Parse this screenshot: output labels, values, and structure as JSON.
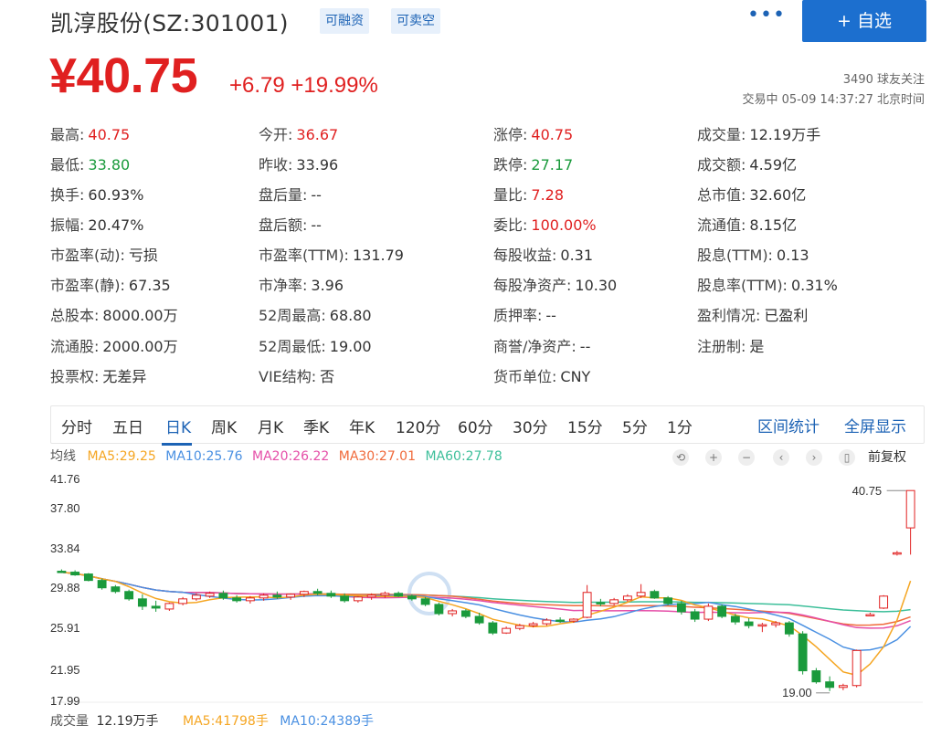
{
  "header": {
    "title": "凯淳股份(SZ:301001)",
    "tag1": "可融资",
    "tag2": "可卖空",
    "more": "•••",
    "add_button": "+ 自选"
  },
  "quote": {
    "price": "¥40.75",
    "change": "+6.79 +19.99%",
    "followers": "3490 球友关注",
    "trade_status": "交易中 05-09 14:37:27 北京时间"
  },
  "stats": [
    [
      {
        "k": "最高:",
        "v": "40.75",
        "c": "r"
      },
      {
        "k": "今开:",
        "v": "36.67",
        "c": "r"
      },
      {
        "k": "涨停:",
        "v": "40.75",
        "c": "r"
      },
      {
        "k": "成交量:",
        "v": "12.19万手",
        "c": "n"
      }
    ],
    [
      {
        "k": "最低:",
        "v": "33.80",
        "c": "g"
      },
      {
        "k": "昨收:",
        "v": "33.96",
        "c": "n"
      },
      {
        "k": "跌停:",
        "v": "27.17",
        "c": "g"
      },
      {
        "k": "成交额:",
        "v": "4.59亿",
        "c": "n"
      }
    ],
    [
      {
        "k": "换手:",
        "v": "60.93%",
        "c": "n"
      },
      {
        "k": "盘后量:",
        "v": "--",
        "c": "n"
      },
      {
        "k": "量比:",
        "v": "7.28",
        "c": "r"
      },
      {
        "k": "总市值:",
        "v": "32.60亿",
        "c": "n"
      }
    ],
    [
      {
        "k": "振幅:",
        "v": "20.47%",
        "c": "n"
      },
      {
        "k": "盘后额:",
        "v": "--",
        "c": "n"
      },
      {
        "k": "委比:",
        "v": "100.00%",
        "c": "r"
      },
      {
        "k": "流通值:",
        "v": "8.15亿",
        "c": "n"
      }
    ],
    [
      {
        "k": "市盈率(动):",
        "v": "亏损",
        "c": "n"
      },
      {
        "k": "市盈率(TTM):",
        "v": "131.79",
        "c": "n"
      },
      {
        "k": "每股收益:",
        "v": "0.31",
        "c": "n"
      },
      {
        "k": "股息(TTM):",
        "v": "0.13",
        "c": "n"
      }
    ],
    [
      {
        "k": "市盈率(静):",
        "v": "67.35",
        "c": "n"
      },
      {
        "k": "市净率:",
        "v": "3.96",
        "c": "n"
      },
      {
        "k": "每股净资产:",
        "v": "10.30",
        "c": "n"
      },
      {
        "k": "股息率(TTM):",
        "v": "0.31%",
        "c": "n"
      }
    ],
    [
      {
        "k": "总股本:",
        "v": "8000.00万",
        "c": "n"
      },
      {
        "k": "52周最高:",
        "v": "68.80",
        "c": "n"
      },
      {
        "k": "质押率:",
        "v": "--",
        "c": "n"
      },
      {
        "k": "盈利情况:",
        "v": "已盈利",
        "c": "n"
      }
    ],
    [
      {
        "k": "流通股:",
        "v": "2000.00万",
        "c": "n"
      },
      {
        "k": "52周最低:",
        "v": "19.00",
        "c": "n"
      },
      {
        "k": "商誉/净资产:",
        "v": "--",
        "c": "n"
      },
      {
        "k": "注册制:",
        "v": "是",
        "c": "n"
      }
    ],
    [
      {
        "k": "投票权:",
        "v": "无差异",
        "c": "n"
      },
      {
        "k": "VIE结构:",
        "v": "否",
        "c": "n"
      },
      {
        "k": "货币单位:",
        "v": "CNY",
        "c": "n"
      },
      null
    ]
  ],
  "tabs": [
    "分时",
    "五日",
    "日K",
    "周K",
    "月K",
    "季K",
    "年K",
    "120分",
    "60分",
    "30分",
    "15分",
    "5分",
    "1分"
  ],
  "active_tab": "日K",
  "tab_right": {
    "stats": "区间统计",
    "fullscreen": "全屏显示"
  },
  "ma_legend": {
    "label": "均线",
    "ma5": "MA5:29.25",
    "ma10": "MA10:25.76",
    "ma20": "MA20:26.22",
    "ma30": "MA30:27.01",
    "ma60": "MA60:27.78"
  },
  "controls": {
    "c1": "⟲",
    "c2": "+",
    "c3": "−",
    "c4": "‹",
    "c5": "›",
    "c6": "▯",
    "adjust": "前复权"
  },
  "colors": {
    "up": "#e02020",
    "down": "#1a9a3c",
    "ma5": "#f5a623",
    "ma10": "#4a90e2",
    "ma20": "#e54fa8",
    "ma30": "#f06a3b",
    "ma60": "#3dbf9a",
    "accent": "#1d63b5"
  },
  "chart_data": {
    "type": "candlestick",
    "y_ticks": [
      "41.76",
      "37.80",
      "33.84",
      "29.88",
      "25.91",
      "21.95",
      "17.99"
    ],
    "ylim": [
      17.99,
      41.76
    ],
    "max_label": "40.75",
    "min_label": "19.00",
    "candles": [
      [
        32.0,
        32.2,
        31.8,
        31.9
      ],
      [
        31.9,
        32.1,
        31.5,
        31.6
      ],
      [
        31.7,
        31.8,
        30.9,
        31.0
      ],
      [
        31.0,
        31.2,
        30.0,
        30.2
      ],
      [
        30.3,
        30.5,
        29.6,
        29.8
      ],
      [
        29.8,
        30.0,
        28.8,
        29.0
      ],
      [
        29.0,
        29.5,
        27.8,
        28.2
      ],
      [
        28.2,
        28.8,
        27.6,
        28.0
      ],
      [
        27.9,
        28.6,
        27.7,
        28.5
      ],
      [
        28.5,
        29.2,
        28.3,
        29.0
      ],
      [
        29.0,
        29.6,
        28.8,
        29.4
      ],
      [
        29.3,
        29.8,
        29.1,
        29.6
      ],
      [
        29.6,
        29.9,
        28.9,
        29.1
      ],
      [
        29.1,
        29.4,
        28.6,
        28.8
      ],
      [
        28.8,
        29.3,
        28.5,
        29.1
      ],
      [
        29.1,
        29.6,
        28.8,
        29.4
      ],
      [
        29.4,
        29.8,
        29.0,
        29.2
      ],
      [
        29.2,
        29.6,
        28.9,
        29.5
      ],
      [
        29.5,
        29.9,
        29.2,
        29.8
      ],
      [
        29.8,
        30.1,
        29.4,
        29.6
      ],
      [
        29.6,
        29.9,
        29.1,
        29.3
      ],
      [
        29.3,
        29.6,
        28.6,
        28.8
      ],
      [
        28.8,
        29.3,
        28.6,
        29.2
      ],
      [
        29.2,
        29.6,
        28.9,
        29.4
      ],
      [
        29.4,
        29.8,
        29.1,
        29.6
      ],
      [
        29.6,
        29.8,
        29.2,
        29.3
      ],
      [
        29.3,
        29.5,
        28.8,
        29.0
      ],
      [
        29.0,
        29.2,
        28.2,
        28.4
      ],
      [
        28.4,
        28.6,
        27.2,
        27.4
      ],
      [
        27.4,
        27.9,
        27.1,
        27.7
      ],
      [
        27.7,
        27.9,
        26.9,
        27.1
      ],
      [
        27.1,
        27.5,
        26.2,
        26.4
      ],
      [
        26.4,
        26.6,
        25.1,
        25.3
      ],
      [
        25.3,
        26.0,
        25.2,
        25.8
      ],
      [
        25.8,
        26.3,
        25.6,
        26.1
      ],
      [
        26.1,
        26.5,
        25.9,
        26.3
      ],
      [
        26.3,
        26.9,
        26.1,
        26.7
      ],
      [
        26.7,
        27.0,
        26.4,
        26.6
      ],
      [
        26.6,
        26.9,
        26.4,
        26.8
      ],
      [
        27.0,
        30.5,
        26.9,
        29.7
      ],
      [
        28.6,
        29.0,
        28.2,
        28.5
      ],
      [
        28.5,
        29.1,
        28.3,
        28.9
      ],
      [
        28.9,
        29.5,
        28.7,
        29.3
      ],
      [
        29.3,
        30.6,
        29.1,
        29.7
      ],
      [
        29.8,
        30.0,
        29.0,
        29.1
      ],
      [
        29.1,
        29.3,
        28.3,
        28.5
      ],
      [
        28.5,
        28.8,
        27.3,
        27.6
      ],
      [
        27.6,
        27.9,
        26.5,
        26.8
      ],
      [
        26.8,
        28.5,
        26.6,
        28.2
      ],
      [
        28.2,
        28.4,
        26.9,
        27.1
      ],
      [
        27.1,
        27.4,
        26.2,
        26.5
      ],
      [
        26.5,
        26.9,
        25.8,
        26.1
      ],
      [
        26.1,
        26.4,
        25.4,
        26.2
      ],
      [
        26.2,
        26.6,
        25.9,
        26.4
      ],
      [
        26.4,
        26.6,
        24.9,
        25.2
      ],
      [
        25.2,
        25.5,
        20.8,
        21.2
      ],
      [
        21.2,
        21.5,
        19.8,
        20.0
      ],
      [
        20.0,
        20.6,
        19.0,
        19.4
      ],
      [
        19.4,
        19.8,
        19.1,
        19.6
      ],
      [
        19.6,
        23.5,
        19.4,
        23.4
      ],
      [
        27.3,
        27.5,
        27.1,
        27.3
      ],
      [
        28.0,
        29.4,
        27.9,
        29.3
      ],
      [
        33.9,
        34.2,
        33.7,
        34.0
      ],
      [
        36.7,
        40.75,
        33.8,
        40.75
      ]
    ]
  },
  "volume": {
    "label": "成交量",
    "value": "12.19万手",
    "ma5": "MA5:41798手",
    "ma10": "MA10:24389手"
  }
}
